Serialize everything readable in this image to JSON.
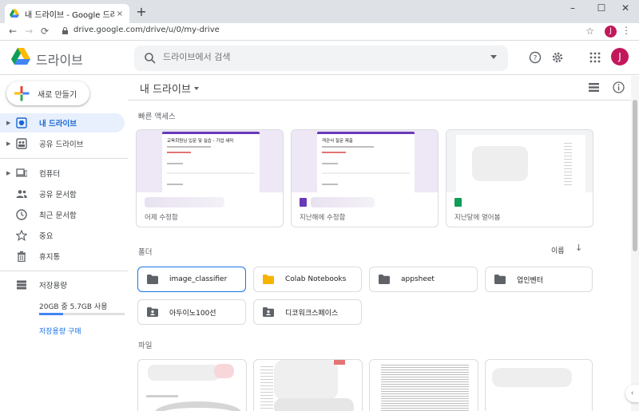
{
  "browser": {
    "tab_title": "내 드라이브 - Google 드라이브",
    "tab_close": "×",
    "new_tab": "+",
    "url": "drive.google.com/drive/u/0/my-drive",
    "profile_initial": "J",
    "window_controls": {
      "minimize": "–",
      "maximize": "☐",
      "close": "✕"
    },
    "nav": {
      "back": "←",
      "forward": "→",
      "reload": "⟳",
      "bookmark": "☆",
      "menu": "⋮"
    }
  },
  "header": {
    "brand": "드라이브",
    "search_placeholder": "드라이브에서 검색",
    "avatar_initial": "J"
  },
  "sidebar": {
    "new_button": "새로 만들기",
    "items": [
      {
        "label": "내 드라이브",
        "icon": "my-drive-icon"
      },
      {
        "label": "공유 드라이브",
        "icon": "shared-drive-icon"
      },
      {
        "label": "컴퓨터",
        "icon": "computer-icon"
      },
      {
        "label": "공유 문서함",
        "icon": "shared-people-icon"
      },
      {
        "label": "최근 문서함",
        "icon": "clock-icon"
      },
      {
        "label": "중요",
        "icon": "star-icon"
      },
      {
        "label": "휴지통",
        "icon": "trash-icon"
      }
    ],
    "storage_label": "저장용량",
    "storage_usage": "20GB 중 5.7GB 사용",
    "storage_fraction": 0.285,
    "buy_storage": "저장용량 구매"
  },
  "main": {
    "title": "내 드라이브",
    "quick_access_label": "빠른 액세스",
    "quick_access": [
      {
        "type": "form",
        "sub": "어제 수정함",
        "doc_title": "교육회원님 입문 및 실습 - 기업 세미"
      },
      {
        "type": "form",
        "sub": "지난해에 수정함",
        "doc_title": "객관식 질문 제출"
      },
      {
        "type": "sheet",
        "sub": "지난달에 열어봄"
      }
    ],
    "folders_label": "폴더",
    "sort_label": "이름",
    "sort_arrow": "↓",
    "folders": [
      {
        "name": "image_classifier",
        "kind": "normal"
      },
      {
        "name": "Colab Notebooks",
        "kind": "colab"
      },
      {
        "name": "appsheet",
        "kind": "normal"
      },
      {
        "name": "업인벤터",
        "kind": "normal"
      },
      {
        "name": "아두이노100선",
        "kind": "shared"
      },
      {
        "name": "디코워크스페이스",
        "kind": "shared"
      }
    ],
    "files_label": "파일"
  },
  "colors": {
    "accent": "#1a73e8",
    "form_purple": "#673ab7",
    "sheet_green": "#0f9d58",
    "colab_folder": "#f4b400",
    "avatar": "#c2185b"
  }
}
